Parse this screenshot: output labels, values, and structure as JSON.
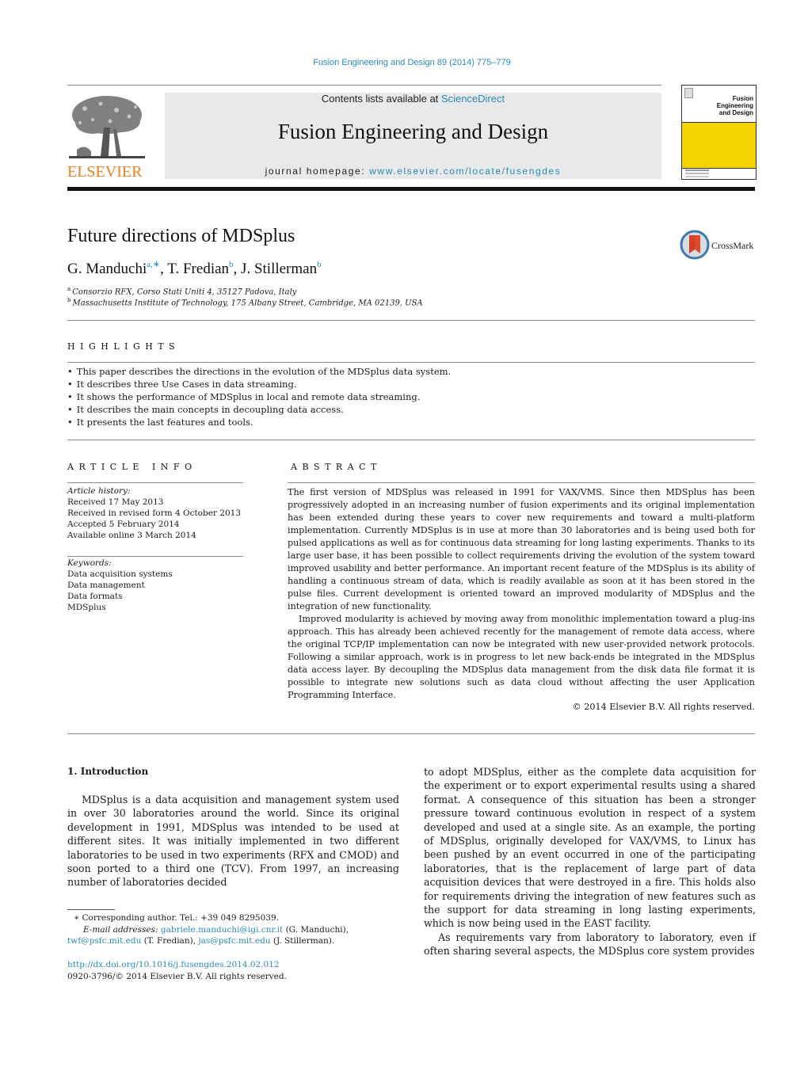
{
  "citation": "Fusion Engineering and Design 89 (2014) 775–779",
  "header": {
    "publisher_logo_text": "ELSEVIER",
    "contents_prefix": "Contents lists available at ",
    "contents_link": "ScienceDirect",
    "journal_title": "Fusion Engineering and Design",
    "homepage_prefix": "journal homepage: ",
    "homepage_link": "www.elsevier.com/locate/fusengdes",
    "cover_title_line1": "Fusion Engineering",
    "cover_title_line2": "and Design",
    "colors": {
      "link": "#2a8ab8",
      "elsevier_orange": "#f07f1a",
      "cover_yellow": "#f5d300",
      "banner_bg": "#e8e9ea"
    }
  },
  "article": {
    "title": "Future directions of MDSplus",
    "authors": [
      {
        "name": "G. Manduchi",
        "sup": "a,∗"
      },
      {
        "name": "T. Fredian",
        "sup": "b"
      },
      {
        "name": "J. Stillerman",
        "sup": "b"
      }
    ],
    "affiliations": [
      {
        "key": "a",
        "text": "Consorzio RFX, Corso Stati Uniti 4, 35127 Padova, Italy"
      },
      {
        "key": "b",
        "text": "Massachusetts Institute of Technology, 175 Albany Street, Cambridge, MA 02139, USA"
      }
    ],
    "crossmark_label": "CrossMark"
  },
  "highlights": {
    "title": "HIGHLIGHTS",
    "items": [
      "This paper describes the directions in the evolution of the MDSplus data system.",
      "It describes three Use Cases in data streaming.",
      "It shows the performance of MDSplus in local and remote data streaming.",
      "It describes the main concepts in decoupling data access.",
      "It presents the last features and tools."
    ]
  },
  "article_info": {
    "title": "ARTICLE INFO",
    "history_label": "Article history:",
    "history": [
      "Received 17 May 2013",
      "Received in revised form 4 October 2013",
      "Accepted 5 February 2014",
      "Available online 3 March 2014"
    ],
    "keywords_label": "Keywords:",
    "keywords": [
      "Data acquisition systems",
      "Data management",
      "Data formats",
      "MDSplus"
    ]
  },
  "abstract": {
    "title": "ABSTRACT",
    "paragraphs": [
      "The first version of MDSplus was released in 1991 for VAX/VMS. Since then MDSplus has been progressively adopted in an increasing number of fusion experiments and its original implementation has been extended during these years to cover new requirements and toward a multi-platform implementation. Currently MDSplus is in use at more than 30 laboratories and is being used both for pulsed applications as well as for continuous data streaming for long lasting experiments. Thanks to its large user base, it has been possible to collect requirements driving the evolution of the system toward improved usability and better performance. An important recent feature of the MDSplus is its ability of handling a continuous stream of data, which is readily available as soon at it has been stored in the pulse files. Current development is oriented toward an improved modularity of MDSplus and the integration of new functionality.",
      "Improved modularity is achieved by moving away from monolithic implementation toward a plug-ins approach. This has already been achieved recently for the management of remote data access, where the original TCP/IP implementation can now be integrated with new user-provided network protocols. Following a similar approach, work is in progress to let new back-ends be integrated in the MDSplus data access layer. By decoupling the MDSplus data management from the disk data file format it is possible to integrate new solutions such as data cloud without affecting the user Application Programming Interface."
    ],
    "copyright": "© 2014 Elsevier B.V. All rights reserved."
  },
  "body": {
    "intro_heading": "1.  Introduction",
    "left_paragraphs": [
      "MDSplus is a data acquisition and management system used in over 30 laboratories around the world. Since its original development in 1991, MDSplus was intended to be used at different sites. It was initially implemented in two different laboratories to be used in two experiments (RFX and CMOD) and soon ported to a third one (TCV). From 1997, an increasing number of laboratories decided"
    ],
    "right_paragraphs": [
      "to adopt MDSplus, either as the complete data acquisition for the experiment or to export experimental results using a shared format. A consequence of this situation has been a stronger pressure toward continuous evolution in respect of a system developed and used at a single site. As an example, the porting of MDSplus, originally developed for VAX/VMS, to Linux has been pushed by an event occurred in one of the participating laboratories, that is the replacement of large part of data acquisition devices that were destroyed in a fire. This holds also for requirements driving the integration of new features such as the support for data streaming in long lasting experiments, which is now being used in the EAST facility.",
      "As requirements vary from laboratory to laboratory, even if often sharing several aspects, the MDSplus core system provides"
    ]
  },
  "footnotes": {
    "corresponding": "∗  Corresponding author. Tel.: +39 049 8295039.",
    "email_label": "E-mail addresses:",
    "emails": [
      {
        "address": "gabriele.manduchi@igi.cnr.it",
        "owner": " (G. Manduchi), "
      },
      {
        "address": "twf@psfc.mit.edu",
        "owner": " (T. Fredian), "
      },
      {
        "address": "jas@psfc.mit.edu",
        "owner": " (J. Stillerman)."
      }
    ],
    "doi": "http://dx.doi.org/10.1016/j.fusengdes.2014.02.012",
    "issn_copyright": "0920-3796/© 2014 Elsevier B.V. All rights reserved."
  }
}
